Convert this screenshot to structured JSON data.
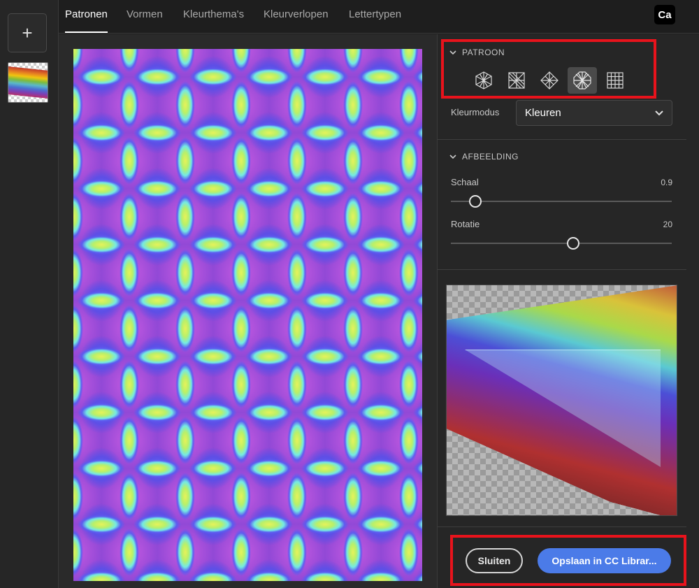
{
  "app": {
    "logo_text": "Ca",
    "add_button_label": "+"
  },
  "tabs": [
    {
      "label": "Patronen",
      "active": true
    },
    {
      "label": "Vormen",
      "active": false
    },
    {
      "label": "Kleurthema's",
      "active": false
    },
    {
      "label": "Kleurverlopen",
      "active": false
    },
    {
      "label": "Lettertypen",
      "active": false
    }
  ],
  "panel": {
    "pattern_section": {
      "title": "PATROON",
      "icons": [
        {
          "name": "hexagon-grid-icon",
          "selected": false
        },
        {
          "name": "square-diagonal-icon",
          "selected": false
        },
        {
          "name": "diamond-icon",
          "selected": false
        },
        {
          "name": "octagon-radial-icon",
          "selected": true
        },
        {
          "name": "grid-icon",
          "selected": false
        }
      ]
    },
    "color_mode": {
      "label": "Kleurmodus",
      "value": "Kleuren"
    },
    "image_section": {
      "title": "AFBEELDING",
      "scale": {
        "label": "Schaal",
        "value": "0.9",
        "fraction": 0.11
      },
      "rotation": {
        "label": "Rotatie",
        "value": "20",
        "fraction": 0.555
      }
    },
    "buttons": {
      "close_label": "Sluiten",
      "save_label": "Opslaan in CC Librar..."
    }
  },
  "colors": {
    "accent": "#4b7be8",
    "highlight": "#e8131c"
  }
}
